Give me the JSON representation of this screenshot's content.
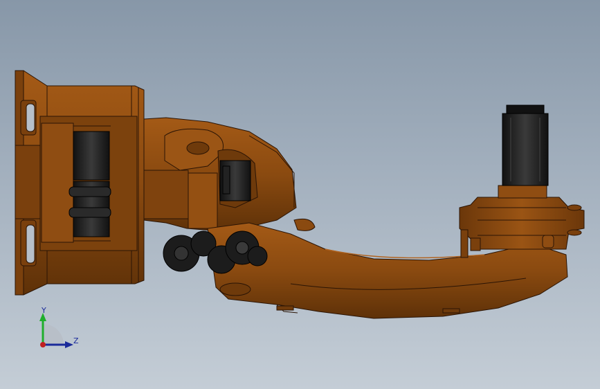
{
  "viewport": {
    "background_top": "#8797a8",
    "background_bottom": "#c4cdd6",
    "model_color": "#8a4a10",
    "model_edge_color": "#2a1405",
    "motor_color": "#1c1c1c"
  },
  "triad": {
    "y_label": "Y",
    "z_label": "Z",
    "y_color": "#1fae2c",
    "z_color": "#1a2a9a",
    "origin_color": "#c02020"
  }
}
